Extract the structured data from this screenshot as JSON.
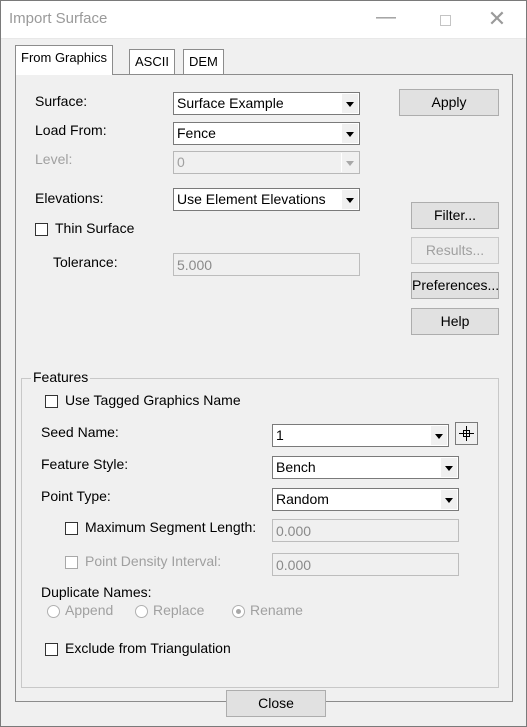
{
  "window": {
    "title": "Import Surface",
    "minimize": "—",
    "close": "✕"
  },
  "tabs": [
    {
      "label": "From Graphics",
      "active": true
    },
    {
      "label": "ASCII",
      "active": false
    },
    {
      "label": "DEM",
      "active": false
    }
  ],
  "surface": {
    "label": "Surface:",
    "value": "Surface Example"
  },
  "load_from": {
    "label": "Load From:",
    "value": "Fence"
  },
  "level": {
    "label": "Level:",
    "value": "0"
  },
  "elevations": {
    "label": "Elevations:",
    "value": "Use Element Elevations"
  },
  "thin_surface": {
    "label": "Thin Surface",
    "checked": false
  },
  "tolerance": {
    "label": "Tolerance:",
    "value": "5.000"
  },
  "buttons": {
    "apply": "Apply",
    "filter": "Filter...",
    "results": "Results...",
    "preferences": "Preferences...",
    "help": "Help",
    "close": "Close"
  },
  "features": {
    "title": "Features",
    "use_tagged": {
      "label": "Use Tagged Graphics Name",
      "checked": false
    },
    "seed_name": {
      "label": "Seed Name:",
      "value": "1"
    },
    "feature_style": {
      "label": "Feature Style:",
      "value": "Bench"
    },
    "point_type": {
      "label": "Point Type:",
      "value": "Random"
    },
    "max_segment": {
      "label": "Maximum Segment Length:",
      "value": "0.000",
      "checked": false
    },
    "point_density": {
      "label": "Point Density Interval:",
      "value": "0.000",
      "checked": false
    },
    "duplicate_names": {
      "label": "Duplicate Names:",
      "options": [
        "Append",
        "Replace",
        "Rename"
      ],
      "selected": "Rename"
    },
    "exclude_triangulation": {
      "label": "Exclude from Triangulation",
      "checked": false
    }
  }
}
